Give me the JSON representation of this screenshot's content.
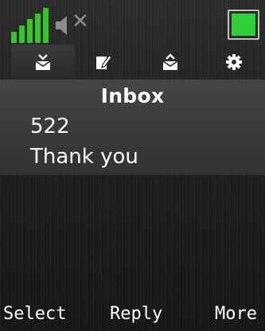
{
  "status_bar": {
    "signal_level": 5,
    "signal_color": "#37c52c",
    "sound_state": "muted",
    "battery_level": 1.0,
    "battery_color": "#2fd13a",
    "icons": [
      "signal-icon",
      "speaker-icon",
      "mute-icon",
      "battery-icon"
    ]
  },
  "tabs": [
    {
      "icon": "inbox-icon",
      "active": true
    },
    {
      "icon": "write-message-icon",
      "active": false
    },
    {
      "icon": "outbox-icon",
      "active": false
    },
    {
      "icon": "settings-icon",
      "active": false
    }
  ],
  "main": {
    "title": "Inbox",
    "message": {
      "sender": "522",
      "preview": "Thank you"
    }
  },
  "softkeys": {
    "left": "Select",
    "center": "Reply",
    "right": "More"
  }
}
